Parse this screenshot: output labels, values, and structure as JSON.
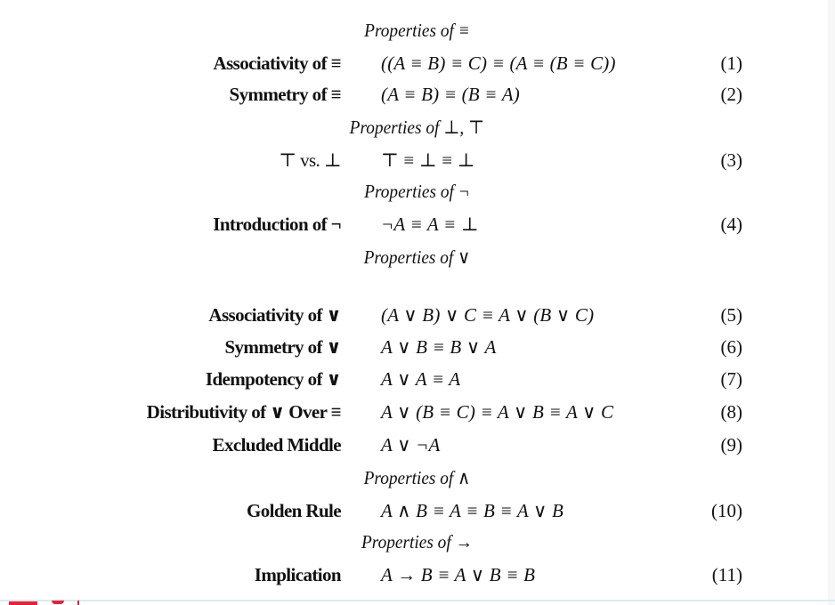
{
  "sections": [
    {
      "heading": "Properties of ≡",
      "rows": [
        {
          "label": "Associativity of ≡",
          "formula": "((A ≡ B) ≡ C) ≡ (A ≡ (B ≡ C))",
          "number": "(1)"
        },
        {
          "label": "Symmetry of ≡",
          "formula": "(A ≡ B) ≡ (B ≡ A)",
          "number": "(2)"
        }
      ]
    },
    {
      "heading": "Properties of ⊥, ⊤",
      "rows": [
        {
          "label": "⊤ vs. ⊥",
          "formula": "⊤ ≡ ⊥ ≡ ⊥",
          "number": "(3)"
        }
      ]
    },
    {
      "heading": "Properties of ¬",
      "rows": [
        {
          "label": "Introduction of ¬",
          "formula": "¬A ≡ A ≡ ⊥",
          "number": "(4)"
        }
      ]
    },
    {
      "heading": "Properties of ∨",
      "rows": [
        {
          "label": "Associativity of ∨",
          "formula": "(A ∨ B) ∨ C ≡ A ∨ (B ∨ C)",
          "number": "(5)"
        },
        {
          "label": "Symmetry of ∨",
          "formula": "A ∨ B ≡ B ∨ A",
          "number": "(6)"
        },
        {
          "label": "Idempotency of ∨",
          "formula": "A ∨ A ≡ A",
          "number": "(7)"
        },
        {
          "label": "Distributivity of ∨ Over ≡",
          "formula": "A ∨ (B ≡ C) ≡ A ∨ B ≡ A ∨ C",
          "number": "(8)"
        },
        {
          "label": "Excluded Middle",
          "formula": "A ∨ ¬A",
          "number": "(9)"
        }
      ]
    },
    {
      "heading": "Properties of ∧",
      "rows": [
        {
          "label": "Golden Rule",
          "formula": "A ∧ B ≡ A ≡ B ≡ A ∨ B",
          "number": "(10)"
        }
      ]
    },
    {
      "heading": "Properties of →",
      "rows": [
        {
          "label": "Implication",
          "formula": "A → B ≡ A ∨ B ≡ B",
          "number": "(11)"
        }
      ]
    }
  ],
  "colors": {
    "text": "#111111",
    "rule": "#d6ecf1",
    "logo_accent": "#e8213a"
  }
}
